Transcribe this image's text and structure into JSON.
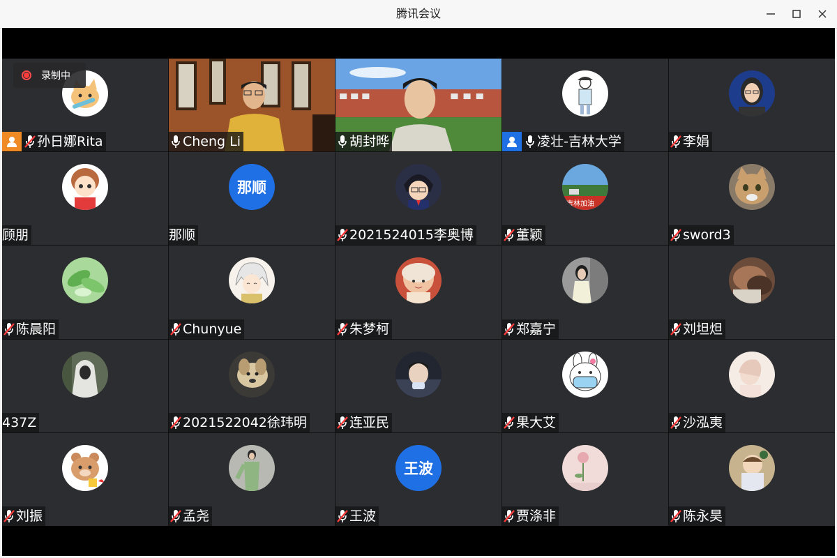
{
  "window": {
    "title": "腾讯会议"
  },
  "recording": {
    "label": "录制中",
    "color": "#ff3b3b"
  },
  "accent": "#1f6fe5",
  "host_color": "#f08a24",
  "participants": [
    {
      "name": "孙日娜Rita",
      "mic": "muted",
      "badge": "host",
      "avatar": "cat-cartoon"
    },
    {
      "name": "Cheng Li",
      "mic": "on",
      "video": "video-man-study"
    },
    {
      "name": "胡封晔",
      "mic": "on",
      "video": "video-man-campus"
    },
    {
      "name": "凌壮-吉林大学",
      "mic": "on",
      "badge": "cohost",
      "avatar": "sketch-person"
    },
    {
      "name": "李娟",
      "mic": "muted",
      "avatar": "woman-photo"
    },
    {
      "name": "顾朋",
      "mic": "none",
      "avatar": "boy-cartoon"
    },
    {
      "name": "那顺",
      "mic": "none",
      "avatar_text": "那顺"
    },
    {
      "name": "2021524015李奥博",
      "mic": "muted",
      "avatar": "anime-boy"
    },
    {
      "name": "董颖",
      "mic": "muted",
      "avatar": "landscape-banner"
    },
    {
      "name": "sword3",
      "mic": "muted",
      "avatar": "cat-photo"
    },
    {
      "name": "陈晨阳",
      "mic": "muted",
      "avatar": "green-leaves"
    },
    {
      "name": "Chunyue",
      "mic": "muted",
      "avatar": "anime-white-hair"
    },
    {
      "name": "朱梦柯",
      "mic": "muted",
      "avatar": "girl-cartoon"
    },
    {
      "name": "郑嘉宁",
      "mic": "muted",
      "avatar": "woman-grey"
    },
    {
      "name": "刘坦炟",
      "mic": "muted",
      "avatar": "blurred-photo"
    },
    {
      "name": "437Z",
      "mic": "none",
      "avatar": "hooded-figure"
    },
    {
      "name": "2021522042徐玮明",
      "mic": "muted",
      "avatar": "dog-photo"
    },
    {
      "name": "连亚民",
      "mic": "muted",
      "avatar": "man-car"
    },
    {
      "name": "果大艾",
      "mic": "muted",
      "avatar": "bunny-mask"
    },
    {
      "name": "沙泓夷",
      "mic": "muted",
      "avatar": "soft-pink-girl"
    },
    {
      "name": "刘振",
      "mic": "muted",
      "avatar": "bear-cartoon"
    },
    {
      "name": "孟尧",
      "mic": "muted",
      "avatar": "man-standing"
    },
    {
      "name": "王波",
      "mic": "muted",
      "avatar_text": "王波"
    },
    {
      "name": "贾涤非",
      "mic": "muted",
      "avatar": "pink-flower"
    },
    {
      "name": "陈永昊",
      "mic": "muted",
      "avatar": "child-photo"
    }
  ]
}
